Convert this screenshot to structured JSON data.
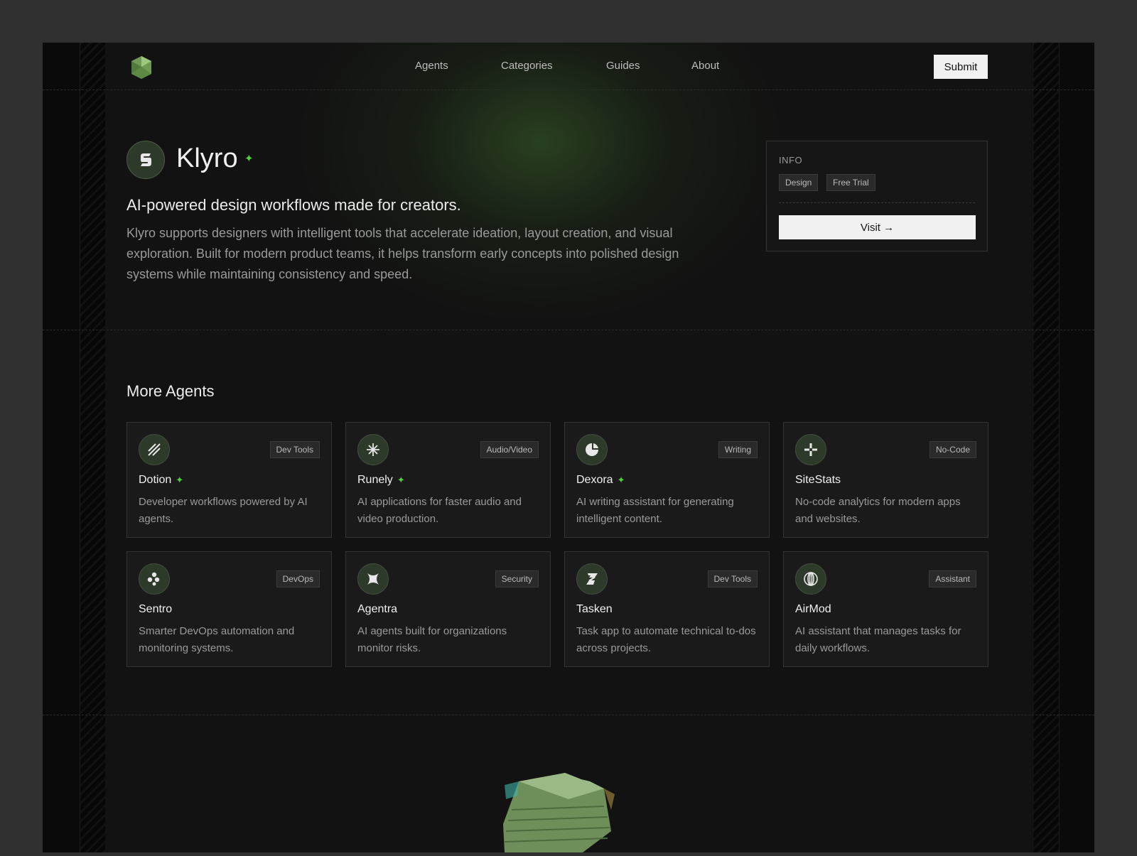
{
  "nav": {
    "links": [
      "Agents",
      "Categories",
      "Guides",
      "About"
    ],
    "submit_label": "Submit"
  },
  "hero": {
    "name": "Klyro",
    "tagline": "AI-powered design workflows made for creators.",
    "description": "Klyro supports designers with intelligent tools that accelerate ideation, layout creation, and visual exploration. Built for modern product teams, it helps transform early concepts into polished design systems while maintaining consistency and speed."
  },
  "info": {
    "label": "INFO",
    "tags": [
      "Design",
      "Free Trial"
    ],
    "visit_label": "Visit →"
  },
  "more_agents": {
    "title": "More Agents",
    "cards": [
      {
        "name": "Dotion",
        "category": "Dev Tools",
        "description": "Developer workflows powered by AI agents.",
        "featured": true,
        "icon": "diagonal-lines-icon"
      },
      {
        "name": "Runely",
        "category": "Audio/Video",
        "description": "AI applications for faster audio and video production.",
        "featured": true,
        "icon": "asterisk-icon"
      },
      {
        "name": "Dexora",
        "category": "Writing",
        "description": "AI writing assistant for generating intelligent content.",
        "featured": true,
        "icon": "pie-segment-icon"
      },
      {
        "name": "SiteStats",
        "category": "No-Code",
        "description": "No-code analytics for modern apps and websites.",
        "featured": false,
        "icon": "plus-split-icon"
      },
      {
        "name": "Sentro",
        "category": "DevOps",
        "description": "Smarter DevOps automation and monitoring systems.",
        "featured": false,
        "icon": "dots-cluster-icon"
      },
      {
        "name": "Agentra",
        "category": "Security",
        "description": "AI agents built for organizations monitor risks.",
        "featured": false,
        "icon": "four-point-star-icon"
      },
      {
        "name": "Tasken",
        "category": "Dev Tools",
        "description": "Task app to automate technical to-dos across projects.",
        "featured": false,
        "icon": "slash-blocks-icon"
      },
      {
        "name": "AirMod",
        "category": "Assistant",
        "description": "AI assistant that manages tasks for daily workflows.",
        "featured": false,
        "icon": "globe-lines-icon"
      }
    ]
  },
  "colors": {
    "accent": "#4cd43a",
    "icon_bg": "#2d3a2a"
  }
}
